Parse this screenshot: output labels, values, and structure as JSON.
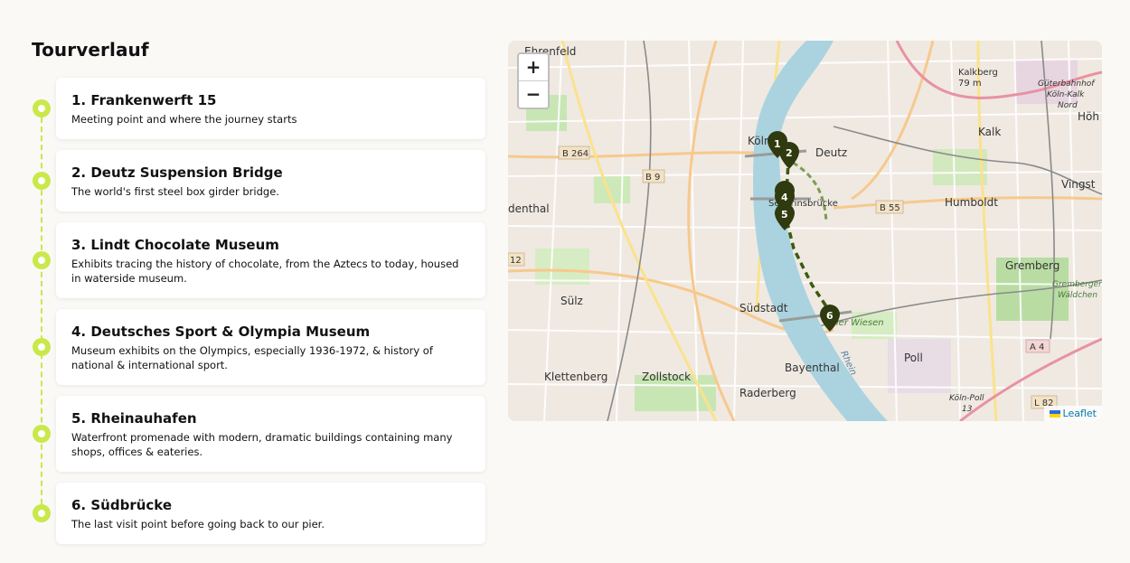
{
  "heading": "Tourverlauf",
  "stops": [
    {
      "title": "1. Frankenwerft 15",
      "description": "Meeting point and where the journey starts"
    },
    {
      "title": "2. Deutz Suspension Bridge",
      "description": "The world's first steel box girder bridge."
    },
    {
      "title": "3. Lindt Chocolate Museum",
      "description": "Exhibits tracing the history of chocolate, from the Aztecs to today, housed in waterside museum."
    },
    {
      "title": "4. Deutsches Sport & Olympia Museum",
      "description": "Museum exhibits on the Olympics, especially 1936-1972, & history of national & international sport."
    },
    {
      "title": "5. Rheinauhafen",
      "description": "Waterfront promenade with modern, dramatic buildings containing many shops, offices & eateries."
    },
    {
      "title": "6. Südbrücke",
      "description": "The last visit point before going back to our pier."
    }
  ],
  "map": {
    "zoom_in": "+",
    "zoom_out": "−",
    "attribution": "Leaflet",
    "labels": {
      "ehrenfeld": "Ehrenfeld",
      "koeln": "Köln",
      "deutz": "Deutz",
      "kalk": "Kalk",
      "kalkberg": "Kalkberg",
      "kalkberg_alt": "79 m",
      "gbf1": "Güterbahnhof",
      "gbf2": "Köln-Kalk",
      "gbf3": "Nord",
      "hoeh": "Höh",
      "vingst": "Vingst",
      "humboldt": "Humboldt",
      "severinsbruecke": "Severinsbrücke",
      "dethal": "denthal",
      "suelz": "Sülz",
      "suedstadt": "Südstadt",
      "gremberg": "Gremberg",
      "grembergerw1": "Gremberger",
      "grembergerw2": "Wäldchen",
      "poller": "oller Wiesen",
      "rhein": "Rhein",
      "poll": "Poll",
      "klettenberg": "Klettenberg",
      "zollstock": "Zollstock",
      "bayenthal": "Bayenthal",
      "raderberg": "Raderberg",
      "koelnpoll1": "Köln-Poll",
      "koelnpoll2": "13"
    },
    "road_shields": {
      "b264": "B 264",
      "b9": "B 9",
      "b55": "B 55",
      "a4": "A 4",
      "l82": "L 82",
      "n12": "12"
    },
    "markers": [
      "1",
      "2",
      "3",
      "4",
      "5",
      "6"
    ],
    "colors": {
      "marker": "#2f3a0e",
      "route": "#3b5a10",
      "water": "#aad3df",
      "timeline": "#c9e84a"
    }
  }
}
